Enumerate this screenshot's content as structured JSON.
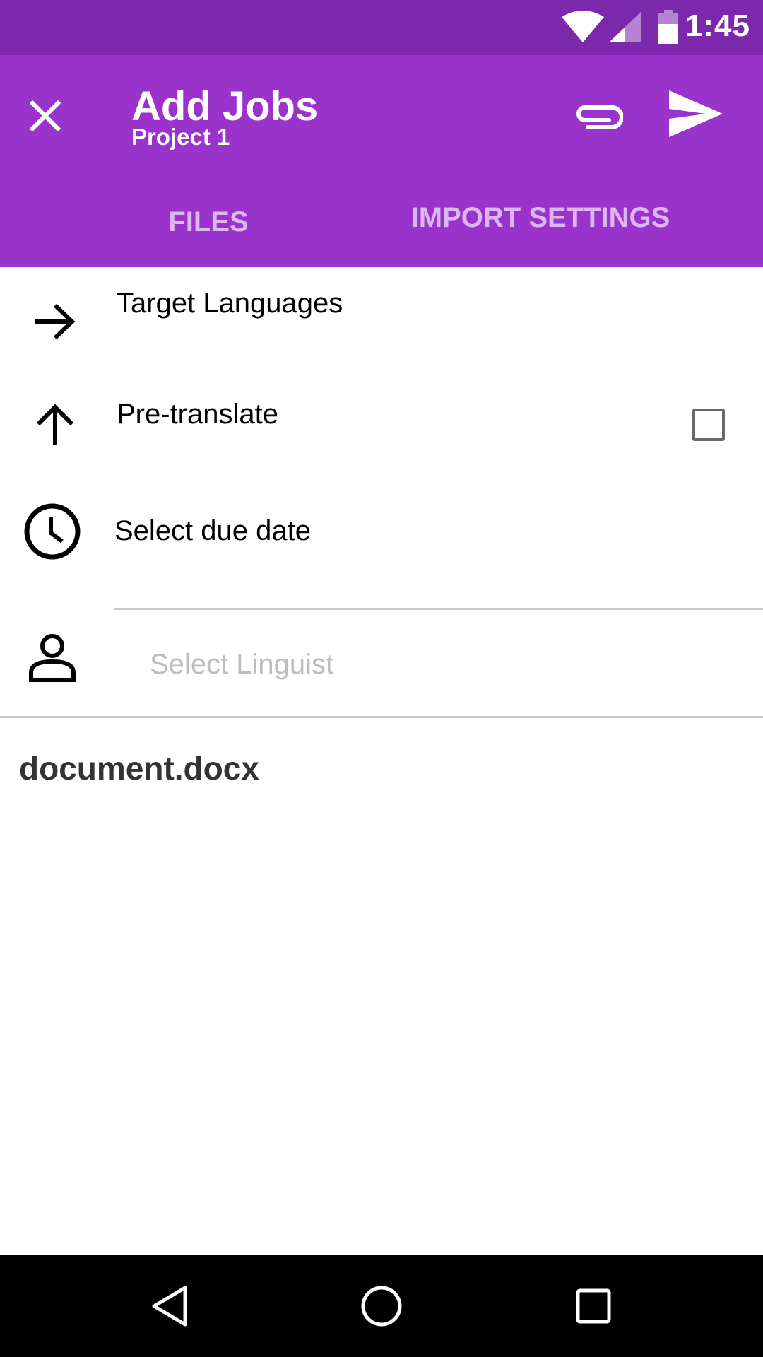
{
  "status_bar": {
    "time": "1:45",
    "icons": [
      "wifi-icon",
      "cell-signal-icon",
      "battery-icon"
    ]
  },
  "app_bar": {
    "title": "Add Jobs",
    "subtitle": "Project 1",
    "actions": [
      "close-icon",
      "attach-icon",
      "send-icon"
    ],
    "background_color": "#9933cc",
    "status_color": "#7b28ad"
  },
  "tabs": [
    {
      "label": "FILES"
    },
    {
      "label": "IMPORT SETTINGS"
    }
  ],
  "form": {
    "target_languages_label": "Target Languages",
    "pretranslate_label": "Pre-translate",
    "pretranslate_checked": false,
    "due_date_label": "Select due date",
    "linguist_placeholder": "Select Linguist",
    "linguist_value": ""
  },
  "files": [
    {
      "name": "document.docx"
    }
  ],
  "nav_bar": {
    "icons": [
      "back-icon",
      "home-icon",
      "recents-icon"
    ]
  }
}
